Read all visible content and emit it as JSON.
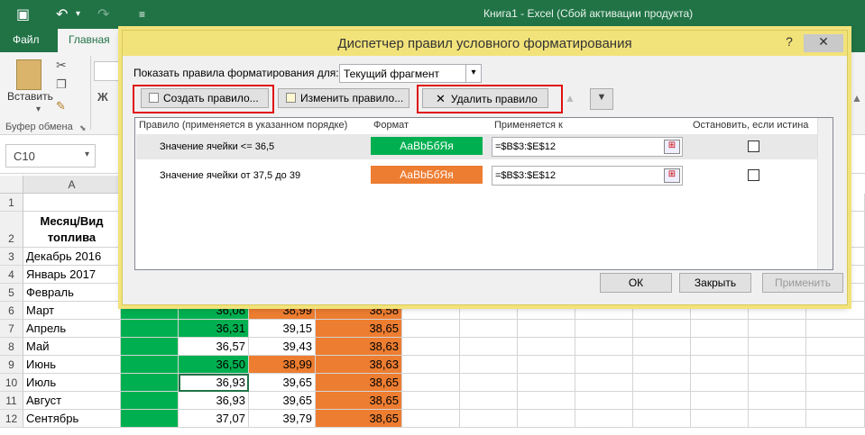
{
  "window": {
    "title": "Книга1 - Excel (Сбой активации продукта)"
  },
  "ribbon": {
    "tabs": [
      "Файл",
      "Главная"
    ],
    "paste_label": "Вставить",
    "clipboard_group": "Буфер обмена",
    "bold_glyph": "Ж"
  },
  "namebox": {
    "value": "C10"
  },
  "sheet": {
    "col_a": "A",
    "rows": [
      {
        "num": "1",
        "a": "",
        "b": "",
        "c": "",
        "d": "",
        "e": "",
        "b_color": "",
        "c_color": "",
        "d_color": "",
        "e_color": ""
      },
      {
        "num": "2",
        "a": "Месяц/Вид топлива",
        "header": true
      },
      {
        "num": "3",
        "a": "Декабрь 2016"
      },
      {
        "num": "4",
        "a": "Январь 2017"
      },
      {
        "num": "5",
        "a": "Февраль"
      },
      {
        "num": "6",
        "a": "Март",
        "c": "36,08",
        "d": "38,99",
        "e": "38,58",
        "c_fill": "green",
        "d_fill": "orange",
        "e_fill": "orange"
      },
      {
        "num": "7",
        "a": "Апрель",
        "c": "36,31",
        "d": "39,15",
        "e": "38,65",
        "c_fill": "green",
        "d_fill": "",
        "e_fill": "orange"
      },
      {
        "num": "8",
        "a": "Май",
        "c": "36,57",
        "d": "39,43",
        "e": "38,63",
        "c_fill": "",
        "d_fill": "",
        "e_fill": "orange"
      },
      {
        "num": "9",
        "a": "Июнь",
        "c": "36,50",
        "d": "38,99",
        "e": "38,63",
        "c_fill": "green",
        "d_fill": "orange",
        "e_fill": "orange"
      },
      {
        "num": "10",
        "a": "Июль",
        "c": "36,93",
        "d": "39,65",
        "e": "38,65",
        "c_fill": "",
        "d_fill": "",
        "e_fill": "orange"
      },
      {
        "num": "11",
        "a": "Август",
        "c": "36,93",
        "d": "39,65",
        "e": "38,65",
        "c_fill": "",
        "d_fill": "",
        "e_fill": "orange"
      },
      {
        "num": "12",
        "a": "Сентябрь",
        "c": "37,07",
        "d": "39,79",
        "e": "38,65",
        "c_fill": "",
        "d_fill": "",
        "e_fill": "orange"
      }
    ]
  },
  "dialog": {
    "title": "Диспетчер правил условного форматирования",
    "help": "?",
    "close": "✕",
    "show_rules_label": "Показать правила форматирования для:",
    "show_rules_value": "Текущий фрагмент",
    "new_rule": "Создать правило...",
    "edit_rule": "Изменить правило...",
    "delete_rule": "Удалить правило",
    "columns": {
      "rule": "Правило (применяется в указанном порядке)",
      "format": "Формат",
      "applies_to": "Применяется к",
      "stop": "Остановить, если истина"
    },
    "rules": [
      {
        "name": "Значение ячейки <= 36,5",
        "format_preview": "АаВbБбЯя",
        "format_color": "#00b050",
        "applies": "=$B$3:$E$12"
      },
      {
        "name": "Значение ячейки от 37,5 до 39",
        "format_preview": "АаВbБбЯя",
        "format_color": "#ed7d31",
        "applies": "=$B$3:$E$12"
      }
    ],
    "ok": "ОК",
    "close_btn": "Закрыть",
    "apply": "Применить"
  }
}
